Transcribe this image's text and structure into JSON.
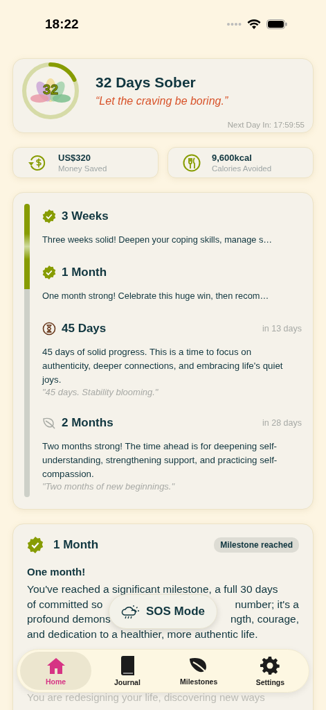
{
  "status_bar": {
    "time": "18:22"
  },
  "summary": {
    "ring_number": "32",
    "level": 0.18,
    "title": "32 Days Sober",
    "quote": "“Let the craving be boring.”",
    "countdown": "Next Day In: 17:59:55"
  },
  "stats": [
    {
      "kind": "money",
      "value": "US$320",
      "label": "Money Saved"
    },
    {
      "kind": "calories",
      "value": "9,600kcal",
      "label": "Calories Avoided"
    }
  ],
  "timeline": {
    "level": 0.29,
    "milestones": [
      {
        "kind": "reached",
        "title": "3 Weeks",
        "description": "Three weeks solid! Deepen your coping skills, manage s…"
      },
      {
        "kind": "reached",
        "title": "1 Month",
        "description": "One month strong! Celebrate this huge win, then recom…"
      },
      {
        "kind": "next",
        "title": "45 Days",
        "eta": "in 13 days",
        "description": "45 days of solid progress. This is a time to focus on authenticity, deeper connections, and embracing life's quiet joys.",
        "quote": "\"45 days. Stability blooming.\""
      },
      {
        "kind": "future",
        "title": "2 Months",
        "eta": "in 28 days",
        "description": "Two months strong! The time ahead is for deepening self-understanding, strengthening support, and practicing self-compassion.",
        "quote": "\"Two months of new beginnings.\""
      }
    ]
  },
  "detail": {
    "title": "1 Month",
    "badge": "Milestone reached",
    "heading": "One month!",
    "lines": [
      [
        "You've reached a significant milestone, a full 30 days"
      ],
      [
        "of committed so",
        "number; it's a"
      ],
      [
        "profound demons",
        "ngth, courage,"
      ],
      [
        "and dedication to a healthier, more authentic life."
      ]
    ],
    "faded_line": "You are redesigning your life, discovering new ways"
  },
  "sos_button": {
    "label": "SOS Mode"
  },
  "tab_bar": [
    {
      "kind": "home",
      "label": "Home",
      "selected": true
    },
    {
      "kind": "journal",
      "label": "Journal",
      "selected": false
    },
    {
      "kind": "milestones",
      "label": "Milestones",
      "selected": false
    },
    {
      "kind": "settings",
      "label": "Settings",
      "selected": false
    }
  ]
}
